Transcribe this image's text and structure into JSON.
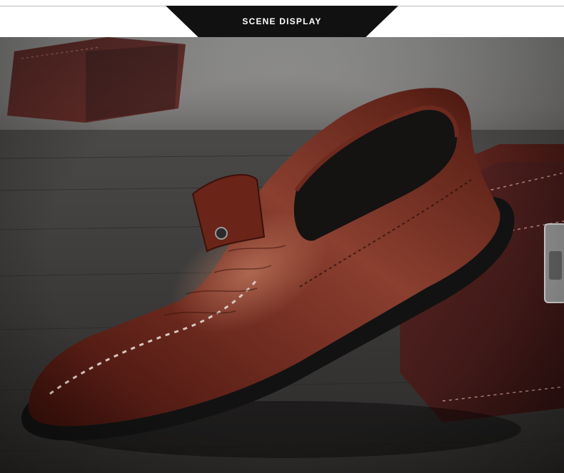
{
  "header": {
    "title": "SCENE DISPLAY"
  },
  "photo": {
    "subject": "shoe-photo",
    "colors": {
      "leather": "#5a1d14",
      "sole": "#121212",
      "table": "#3b3838",
      "box": "#4a1e1c"
    }
  }
}
